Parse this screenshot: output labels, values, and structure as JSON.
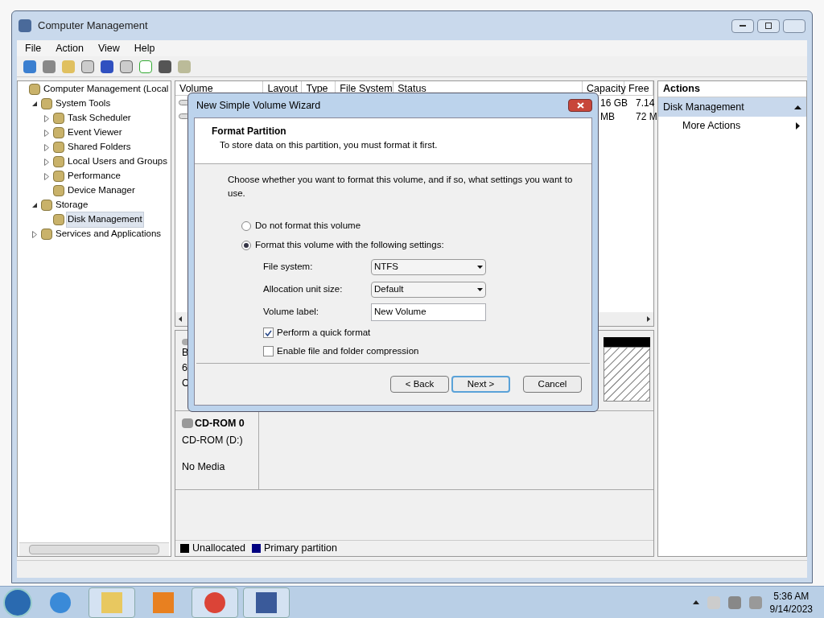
{
  "window": {
    "title": "Computer Management"
  },
  "menu": [
    "File",
    "Action",
    "View",
    "Help"
  ],
  "tree": {
    "label": "Computer Management (Local",
    "children": [
      {
        "label": "System Tools",
        "expanded": true,
        "selected": false,
        "children": [
          {
            "label": "Task Scheduler",
            "expanded": false,
            "selected": false
          },
          {
            "label": "Event Viewer",
            "expanded": false,
            "selected": false
          },
          {
            "label": "Shared Folders",
            "expanded": false,
            "selected": false
          },
          {
            "label": "Local Users and Groups",
            "expanded": false,
            "selected": false
          },
          {
            "label": "Performance",
            "expanded": false,
            "selected": false
          },
          {
            "label": "Device Manager",
            "selected": false
          }
        ]
      },
      {
        "label": "Storage",
        "expanded": true,
        "selected": false,
        "children": [
          {
            "label": "Disk Management",
            "selected": true
          }
        ]
      },
      {
        "label": "Services and Applications",
        "expanded": false,
        "selected": false
      }
    ]
  },
  "table": {
    "columns": [
      "Volume",
      "Layout",
      "Type",
      "File System",
      "Status",
      "Capacity",
      "Free"
    ],
    "rows": [
      {
        "capacity": "16 GB",
        "free": "7.14"
      },
      {
        "capacity": "MB",
        "free": "72 M"
      }
    ]
  },
  "disk_0": {
    "lines": [
      "B",
      "6",
      "C"
    ]
  },
  "cdrom": {
    "name": "CD-ROM 0",
    "drive": "CD-ROM (D:)",
    "media": "No Media"
  },
  "legend": [
    {
      "label": "Unallocated",
      "color": "#000000"
    },
    {
      "label": "Primary partition",
      "color": "#000080"
    }
  ],
  "actions": {
    "title": "Actions",
    "section": "Disk Management",
    "items": [
      "More Actions"
    ]
  },
  "dialog": {
    "title": "New Simple Volume Wizard",
    "heading": "Format Partition",
    "subheading": "To store data on this partition, you must format it first.",
    "prompt": "Choose whether you want to format this volume, and if so, what settings you want to use.",
    "options": [
      {
        "label": "Do not format this volume",
        "selected": false
      },
      {
        "label": "Format this volume with the following settings:",
        "selected": true
      }
    ],
    "fields": [
      {
        "kind": "select",
        "label": "File system:",
        "value": "NTFS"
      },
      {
        "kind": "select",
        "label": "Allocation unit size:",
        "value": "Default"
      },
      {
        "kind": "text",
        "label": "Volume label:",
        "value": "New Volume"
      }
    ],
    "checks": [
      {
        "label": "Perform a quick format",
        "checked": true
      },
      {
        "label": "Enable file and folder compression",
        "checked": false
      }
    ],
    "buttons": [
      {
        "label": "< Back",
        "default": false
      },
      {
        "label": "Next >",
        "default": true
      },
      {
        "label": "Cancel",
        "default": false
      }
    ]
  },
  "taskbar": {
    "apps": [
      {
        "active": false
      },
      {
        "active": true
      },
      {
        "active": false
      },
      {
        "active": true
      },
      {
        "active": true
      }
    ],
    "time": "5:36 AM",
    "date": "9/14/2023"
  }
}
